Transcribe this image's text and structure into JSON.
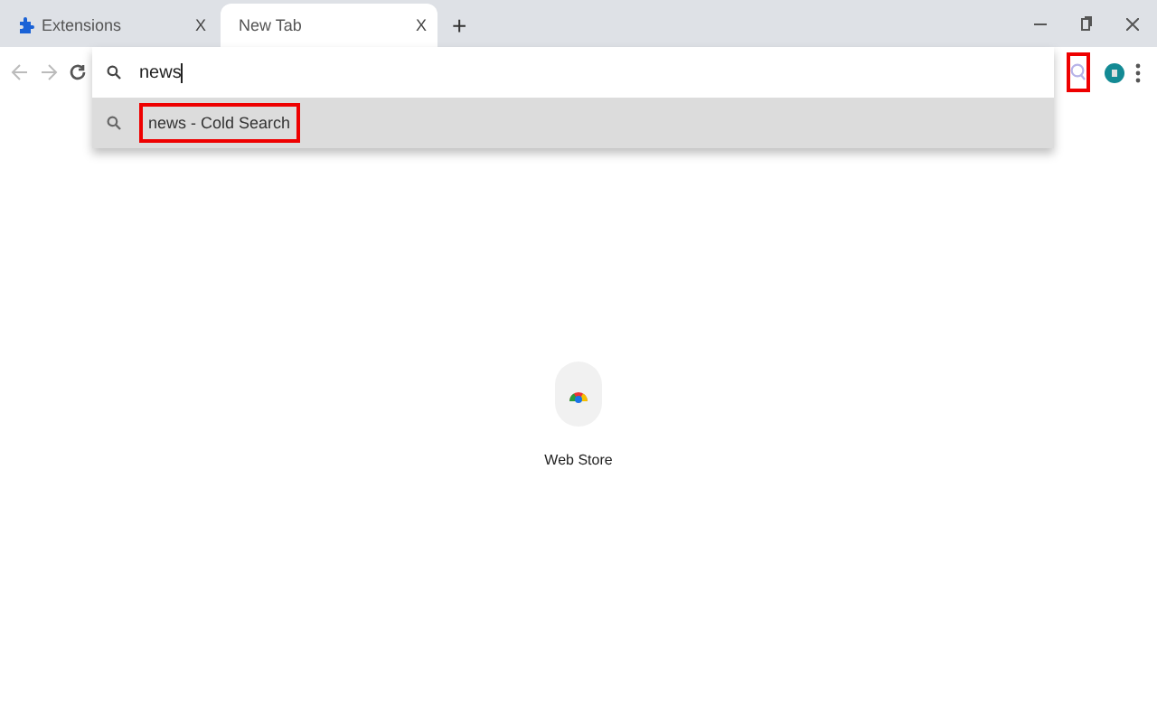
{
  "tabs": [
    {
      "label": "Extensions",
      "close": "X",
      "selected": false
    },
    {
      "label": "New Tab",
      "close": "X",
      "selected": true
    }
  ],
  "new_tab": "+",
  "omnibox": {
    "value": "news",
    "suggestions": [
      {
        "text": "news - Cold Search",
        "outlined": true
      }
    ]
  },
  "extension_button": {
    "outlined": true
  },
  "shortcuts": [
    {
      "label": "Web Store"
    }
  ]
}
